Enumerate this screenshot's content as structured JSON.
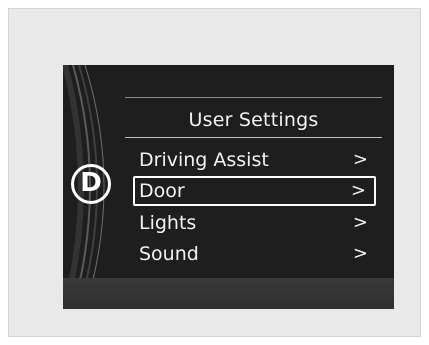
{
  "cluster": {
    "gear": "D",
    "menu": {
      "title": "User Settings",
      "items": [
        {
          "label": "Driving Assist",
          "chevron": ">"
        },
        {
          "label": "Door",
          "chevron": ">",
          "selected": true
        },
        {
          "label": "Lights",
          "chevron": ">"
        },
        {
          "label": "Sound",
          "chevron": ">"
        }
      ]
    }
  }
}
